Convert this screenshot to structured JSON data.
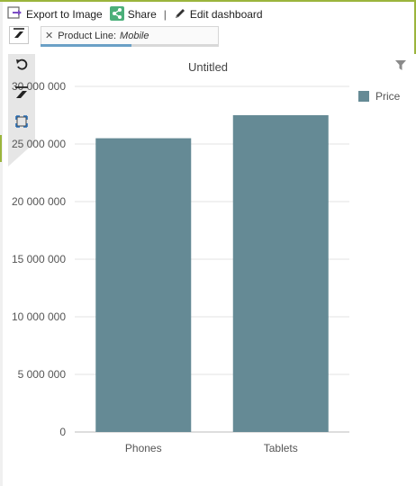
{
  "toolbar": {
    "export_label": "Export to Image",
    "share_label": "Share",
    "separator": "|",
    "edit_label": "Edit dashboard"
  },
  "filter": {
    "field": "Product Line:",
    "value": "Mobile"
  },
  "colors": {
    "accent": "#9bb53c",
    "bar": "#658a95",
    "share_icon_bg": "#4caf7a",
    "export_icon": "#7b4dc4"
  },
  "side_icons": [
    "undo-icon",
    "clear-filter-icon",
    "fit-icon"
  ],
  "chart_data": {
    "type": "bar",
    "title": "Untitled",
    "categories": [
      "Phones",
      "Tablets"
    ],
    "series": [
      {
        "name": "Price",
        "values": [
          25500000,
          27500000
        ]
      }
    ],
    "ylim": [
      0,
      30000000
    ],
    "yticks": [
      "0",
      "5 000 000",
      "10 000 000",
      "15 000 000",
      "20 000 000",
      "25 000 000",
      "30 000 000"
    ],
    "ytick_values": [
      0,
      5000000,
      10000000,
      15000000,
      20000000,
      25000000,
      30000000
    ],
    "grid": true,
    "legend": "top-right"
  }
}
